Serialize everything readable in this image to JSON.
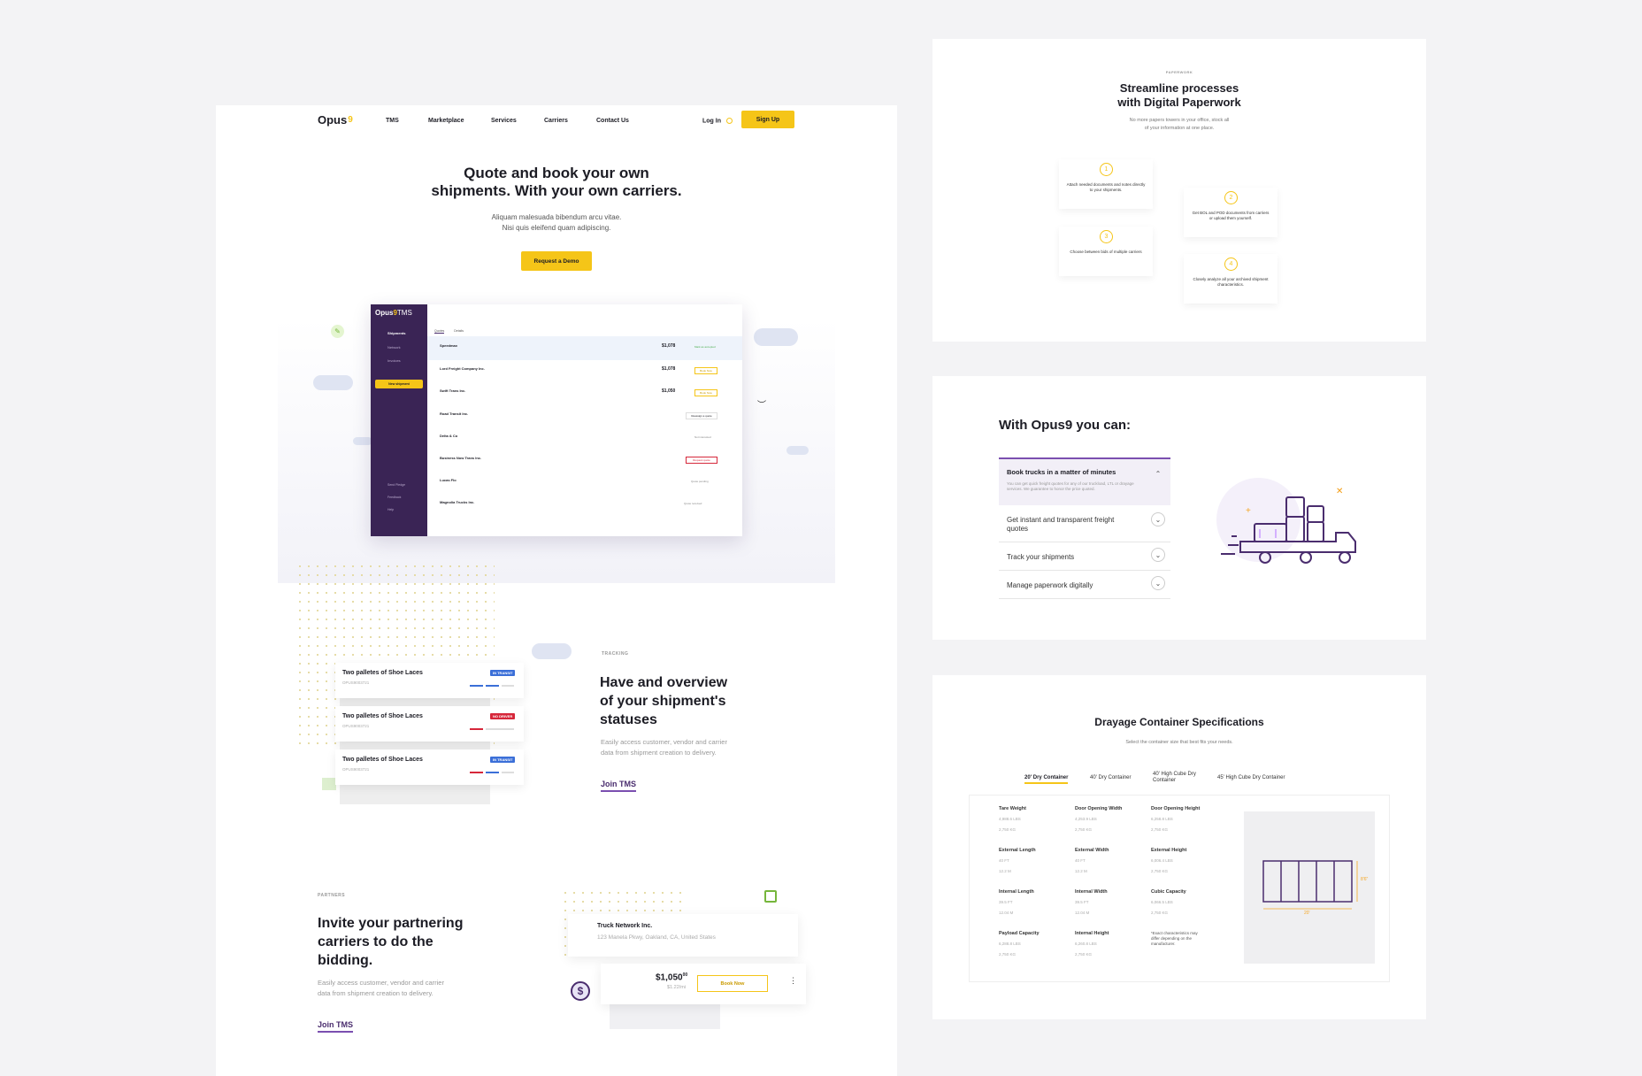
{
  "nav": {
    "logo": "Opus",
    "items": [
      "TMS",
      "Marketplace",
      "Services",
      "Carriers",
      "Contact Us"
    ],
    "login": "Log In",
    "signup": "Sign Up"
  },
  "hero": {
    "title_line1": "Quote and book your own",
    "title_line2": "shipments. With your own carriers.",
    "sub_line1": "Aliquam malesuada bibendum arcu vitae.",
    "sub_line2": "Nisi quis eleifend quam adipiscing.",
    "cta": "Request a Demo"
  },
  "app": {
    "logo": "Opus",
    "logo_suffix": "TMS",
    "nav": [
      "Shipments",
      "Network",
      "Invoices"
    ],
    "new_button": "New shipment",
    "bottom_nav": [
      "Send Pledge",
      "Feedback",
      "Help"
    ],
    "tabs": [
      "Quotes",
      "Details"
    ],
    "rows": [
      {
        "name": "Speedmax",
        "price": "$1,078",
        "action": "Mark as accepted"
      },
      {
        "name": "Lord Freight Company Inc.",
        "price": "$1,078",
        "action": "Book Now"
      },
      {
        "name": "Swift Trans Inc.",
        "price": "$1,050",
        "action": "Book Now"
      },
      {
        "name": "Road Transit Inc.",
        "price": "",
        "action": "Reassign a quote"
      },
      {
        "name": "Delta & Co",
        "price": "",
        "action": "Not interested"
      },
      {
        "name": "Business Now Trans Inc.",
        "price": "",
        "action": "Request quote"
      },
      {
        "name": "Lucas Flo",
        "price": "",
        "action": "Quote pending"
      },
      {
        "name": "Magnolia Trucks Inc.",
        "price": "",
        "action": "Quote received"
      }
    ]
  },
  "tracking": {
    "eyebrow": "TRACKING",
    "title_line1": "Have and overview",
    "title_line2": "of your shipment's",
    "title_line3": "statuses",
    "desc_line1": "Easily access customer, vendor and carrier",
    "desc_line2": "data from shipment creation to delivery.",
    "link": "Join TMS",
    "cards": [
      {
        "title": "Two palletes of Shoe Laces",
        "id": "OPUS9003721",
        "badge": "IN TRANSIT",
        "badge_color": "#3b6fd8"
      },
      {
        "title": "Two palletes of Shoe Laces",
        "id": "OPUS9003721",
        "badge": "NO DRIVER",
        "badge_color": "#d6273a"
      },
      {
        "title": "Two palletes of Shoe Laces",
        "id": "OPUS9003721",
        "badge": "IN TRANSIT",
        "badge_color": "#3b6fd8"
      }
    ]
  },
  "partners": {
    "eyebrow": "PARTNERS",
    "title_line1": "Invite your partnering",
    "title_line2": "carriers to do the",
    "title_line3": "bidding.",
    "desc_line1": "Easily access customer, vendor and carrier",
    "desc_line2": "data from shipment creation to delivery.",
    "link": "Join TMS",
    "carrier_name": "Truck Network Inc.",
    "carrier_address": "123 Manela Pkwy, Oakland, CA, United States",
    "price": "$1,050",
    "price_cents": "00",
    "price_sub": "$1.22/mi",
    "book": "Book Now"
  },
  "paperwork": {
    "eyebrow": "PAPERWORK",
    "title_line1": "Streamline processes",
    "title_line2": "with Digital Paperwork",
    "sub_line1": "No more papers towers in your office, stock all",
    "sub_line2": "of your information at one place.",
    "steps": [
      {
        "num": "1",
        "text": "Attach needed documents and notes directly to your shipments."
      },
      {
        "num": "2",
        "text": "Get BOL and POD documents from carriers or upload them yourself."
      },
      {
        "num": "3",
        "text": "Choose between bids of multiple carriers"
      },
      {
        "num": "4",
        "text": "Closely analyze all your archived shipment characteristics."
      }
    ]
  },
  "features": {
    "title": "With Opus9 you can:",
    "items": [
      {
        "title": "Book trucks in a matter of minutes",
        "body": "You can get quick freight quotes for any of our truckload, LTL or drayage services. We guarantee to honor the price quoted."
      },
      {
        "title": "Get instant and transparent freight quotes"
      },
      {
        "title": "Track your shipments"
      },
      {
        "title": "Manage paperwork digitally"
      }
    ]
  },
  "specs": {
    "title": "Drayage Container Specifications",
    "subtitle": "Select the container size that best fits your needs.",
    "tabs": [
      "20' Dry Container",
      "40' Dry Container",
      "40' High Cube Dry Container",
      "45' High Cube Dry Container"
    ],
    "rows": [
      [
        {
          "label": "Tare Weight",
          "v1": "4,988.6 LBS",
          "v2": "2,750 KG"
        },
        {
          "label": "Door Opening Width",
          "v1": "4,253.9 LBS",
          "v2": "2,750 KG"
        },
        {
          "label": "Door Opening Height",
          "v1": "6,258.8 LBS",
          "v2": "2,750 KG"
        }
      ],
      [
        {
          "label": "External Length",
          "v1": "40 FT",
          "v2": "12.2 M"
        },
        {
          "label": "External Width",
          "v1": "40 FT",
          "v2": "12.2 M"
        },
        {
          "label": "External Height",
          "v1": "6,006.4 LBS",
          "v2": "2,750 KG"
        }
      ],
      [
        {
          "label": "Internal Length",
          "v1": "39.5 FT",
          "v2": "12.04 M"
        },
        {
          "label": "Internal Width",
          "v1": "39.5 FT",
          "v2": "12.04 M"
        },
        {
          "label": "Cubic Capacity",
          "v1": "6,066.5 LBS",
          "v2": "2,750 KG"
        }
      ],
      [
        {
          "label": "Payload Capacity",
          "v1": "6,288.8 LBS",
          "v2": "2,750 KG"
        },
        {
          "label": "Internal Height",
          "v1": "6,260.8 LBS",
          "v2": "2,750 KG"
        },
        {
          "label": "*Exact characteristics may differ depending on the manufacturer.",
          "v1": "",
          "v2": ""
        }
      ]
    ],
    "dim_width": "20'",
    "dim_height": "8'6\""
  }
}
